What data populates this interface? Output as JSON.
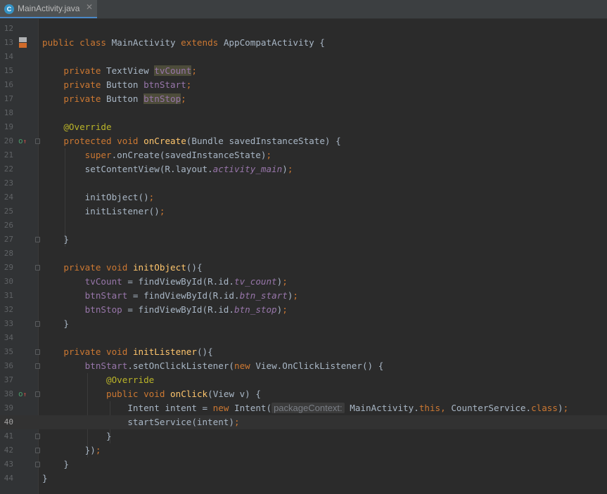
{
  "tab": {
    "icon_letter": "C",
    "label": "MainActivity.java",
    "close": "✕"
  },
  "gutter_icons": {
    "class_icon": "class-implementation-icon",
    "override_icon": "override-marker-icon"
  },
  "lines": {
    "l12": "12",
    "l13": "13",
    "l14": "14",
    "l15": "15",
    "l16": "16",
    "l17": "17",
    "l18": "18",
    "l19": "19",
    "l20": "20",
    "l21": "21",
    "l22": "22",
    "l23": "23",
    "l24": "24",
    "l25": "25",
    "l26": "26",
    "l27": "27",
    "l28": "28",
    "l29": "29",
    "l30": "30",
    "l31": "31",
    "l32": "32",
    "l33": "33",
    "l34": "34",
    "l35": "35",
    "l36": "36",
    "l37": "37",
    "l38": "38",
    "l39": "39",
    "l40": "40",
    "l41": "41",
    "l42": "42",
    "l43": "43",
    "l44": "44"
  },
  "code": {
    "c13": [
      "public",
      " ",
      "class",
      " MainActivity ",
      "extends",
      " AppCompatActivity {"
    ],
    "c15": [
      "private",
      " TextView ",
      "tvCount",
      ";"
    ],
    "c16": [
      "private",
      " Button ",
      "btnStart",
      ";"
    ],
    "c17": [
      "private",
      " Button ",
      "btnStop",
      ";"
    ],
    "c19": [
      "@Override"
    ],
    "c20": [
      "protected",
      " ",
      "void",
      " ",
      "onCreate",
      "(Bundle savedInstanceState) {"
    ],
    "c21": [
      "super",
      ".onCreate(savedInstanceState)",
      ";"
    ],
    "c22": [
      "setContentView(R.layout.",
      "activity_main",
      ")",
      ";"
    ],
    "c24": [
      "initObject()",
      ";"
    ],
    "c25": [
      "initListener()",
      ";"
    ],
    "c27": [
      "}"
    ],
    "c29": [
      "private",
      " ",
      "void",
      " ",
      "initObject",
      "(){"
    ],
    "c30": [
      "tvCount",
      " = findViewById(R.id.",
      "tv_count",
      ")",
      ";"
    ],
    "c31": [
      "btnStart",
      " = findViewById(R.id.",
      "btn_start",
      ")",
      ";"
    ],
    "c32": [
      "btnStop",
      " = findViewById(R.id.",
      "btn_stop",
      ")",
      ";"
    ],
    "c33": [
      "}"
    ],
    "c35": [
      "private",
      " ",
      "void",
      " ",
      "initListener",
      "(){"
    ],
    "c36": [
      "btnStart",
      ".setOnClickListener(",
      "new",
      " View.OnClickListener() {"
    ],
    "c37": [
      "@Override"
    ],
    "c38": [
      "public",
      " ",
      "void",
      " ",
      "onClick",
      "(View v) {"
    ],
    "c39": [
      "Intent intent = ",
      "new",
      " Intent(",
      "packageContext:",
      " MainActivity.",
      "this",
      ", ",
      "CounterService.",
      "class",
      ")",
      ";"
    ],
    "c40": [
      "startService(intent)",
      ";"
    ],
    "c41": [
      "}"
    ],
    "c42": [
      "})",
      ";"
    ],
    "c43": [
      "}"
    ],
    "c44": [
      "}"
    ]
  }
}
